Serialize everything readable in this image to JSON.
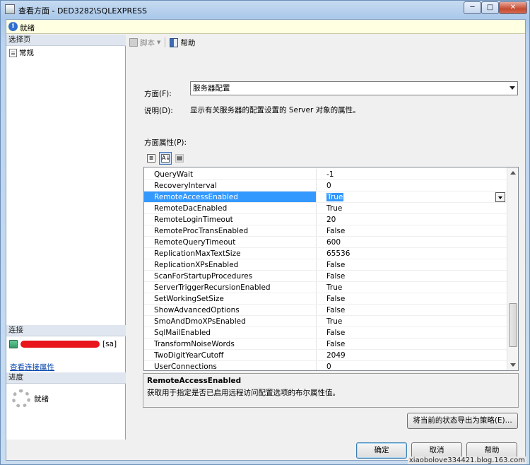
{
  "window": {
    "title": "查看方面 - DED3282\\SQLEXPRESS",
    "buttons": {
      "minimize": "─",
      "maximize": "□",
      "close": "✕"
    }
  },
  "status": {
    "text": "就绪"
  },
  "left": {
    "select_page_header": "选择页",
    "pages": [
      {
        "label": "常规"
      }
    ],
    "connection_header": "连接",
    "connection_suffix": "[sa]",
    "connection_link": "查看连接属性",
    "progress_header": "进度",
    "progress_text": "就绪"
  },
  "toolbar": {
    "script": "脚本",
    "help": "帮助"
  },
  "facet": {
    "label": "方面(F):",
    "value": "服务器配置",
    "desc_label": "说明(D):",
    "desc_text": "显示有关服务器的配置设置的 Server 对象的属性。",
    "props_label": "方面属性(P):"
  },
  "grid_tools": {
    "categorized": "≣",
    "alphabetical": "A↓",
    "pages": "▤"
  },
  "properties": [
    {
      "name": "QueryWait",
      "value": "-1"
    },
    {
      "name": "RecoveryInterval",
      "value": "0"
    },
    {
      "name": "RemoteAccessEnabled",
      "value": "True",
      "selected": true
    },
    {
      "name": "RemoteDacEnabled",
      "value": "True"
    },
    {
      "name": "RemoteLoginTimeout",
      "value": "20"
    },
    {
      "name": "RemoteProcTransEnabled",
      "value": "False"
    },
    {
      "name": "RemoteQueryTimeout",
      "value": "600"
    },
    {
      "name": "ReplicationMaxTextSize",
      "value": "65536"
    },
    {
      "name": "ReplicationXPsEnabled",
      "value": "False"
    },
    {
      "name": "ScanForStartupProcedures",
      "value": "False"
    },
    {
      "name": "ServerTriggerRecursionEnabled",
      "value": "True"
    },
    {
      "name": "SetWorkingSetSize",
      "value": "False"
    },
    {
      "name": "ShowAdvancedOptions",
      "value": "False"
    },
    {
      "name": "SmoAndDmoXPsEnabled",
      "value": "True"
    },
    {
      "name": "SqlMailEnabled",
      "value": "False"
    },
    {
      "name": "TransformNoiseWords",
      "value": "False"
    },
    {
      "name": "TwoDigitYearCutoff",
      "value": "2049"
    },
    {
      "name": "UserConnections",
      "value": "0"
    }
  ],
  "description": {
    "title": "RemoteAccessEnabled",
    "text": "获取用于指定是否已启用远程访问配置选项的布尔属性值。"
  },
  "buttons": {
    "export": "将当前的状态导出为策略(E)...",
    "ok": "确定",
    "cancel": "取消",
    "help": "帮助"
  },
  "watermark": "xiaobolove334421.blog.163.com"
}
